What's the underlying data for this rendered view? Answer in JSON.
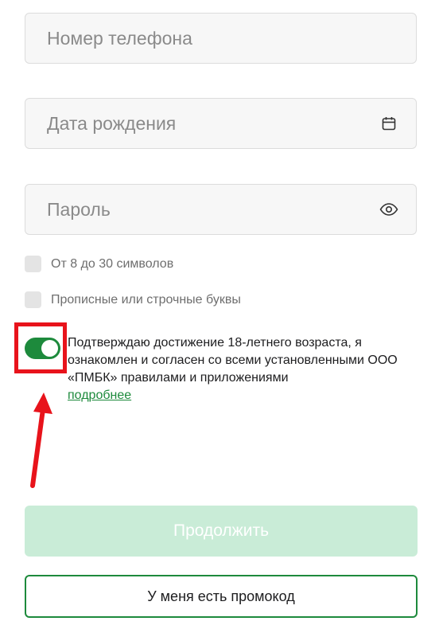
{
  "form": {
    "phone": {
      "placeholder": "Номер телефона",
      "value": ""
    },
    "birthdate": {
      "placeholder": "Дата рождения",
      "value": "",
      "icon": "calendar-icon"
    },
    "password": {
      "placeholder": "Пароль",
      "value": "",
      "icon": "eye-icon"
    }
  },
  "password_rules": [
    {
      "label": "От 8 до 30 символов",
      "checked": false
    },
    {
      "label": "Прописные или строчные буквы",
      "checked": false
    }
  ],
  "consent": {
    "toggle_on": true,
    "text": "Подтверждаю достижение 18-летнего возраста, я ознакомлен и согласен со всеми установленными ООО «ПМБК» правилами и приложениями",
    "link_label": "подробнее"
  },
  "buttons": {
    "continue_label": "Продолжить",
    "promo_label": "У меня есть промокод"
  },
  "colors": {
    "accent": "#1d8a3c",
    "disabled_button": "#c9ecd7",
    "annotation_red": "#e8131b"
  }
}
